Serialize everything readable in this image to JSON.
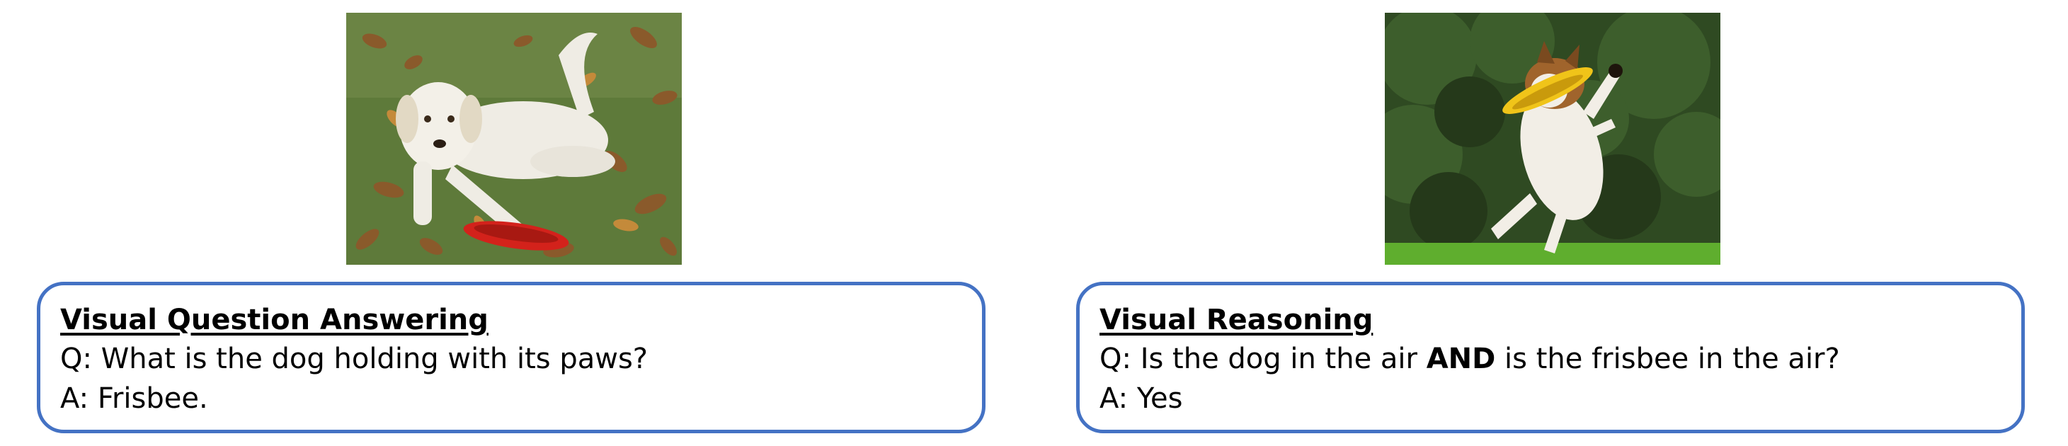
{
  "panels": [
    {
      "title": "Visual Question Answering",
      "question": {
        "prefix": "Q: ",
        "text": "What is the dog holding with its paws?"
      },
      "answer": {
        "prefix": "A: ",
        "text": "Frisbee."
      }
    },
    {
      "title": "Visual Reasoning",
      "question": {
        "prefix": "Q: ",
        "before": "Is the dog in the air ",
        "emphasis": "AND",
        "after": " is the frisbee in the air?"
      },
      "answer": {
        "prefix": "A: ",
        "text": "Yes"
      }
    }
  ],
  "colors": {
    "card_border": "#4472c4",
    "grass": "#5e7a3a",
    "leaves": "#8a5a2b",
    "frisbee_red": "#d3221b",
    "frisbee_yellow": "#f0c419",
    "trees": "#2f4a22",
    "lawn": "#5fae2e"
  }
}
